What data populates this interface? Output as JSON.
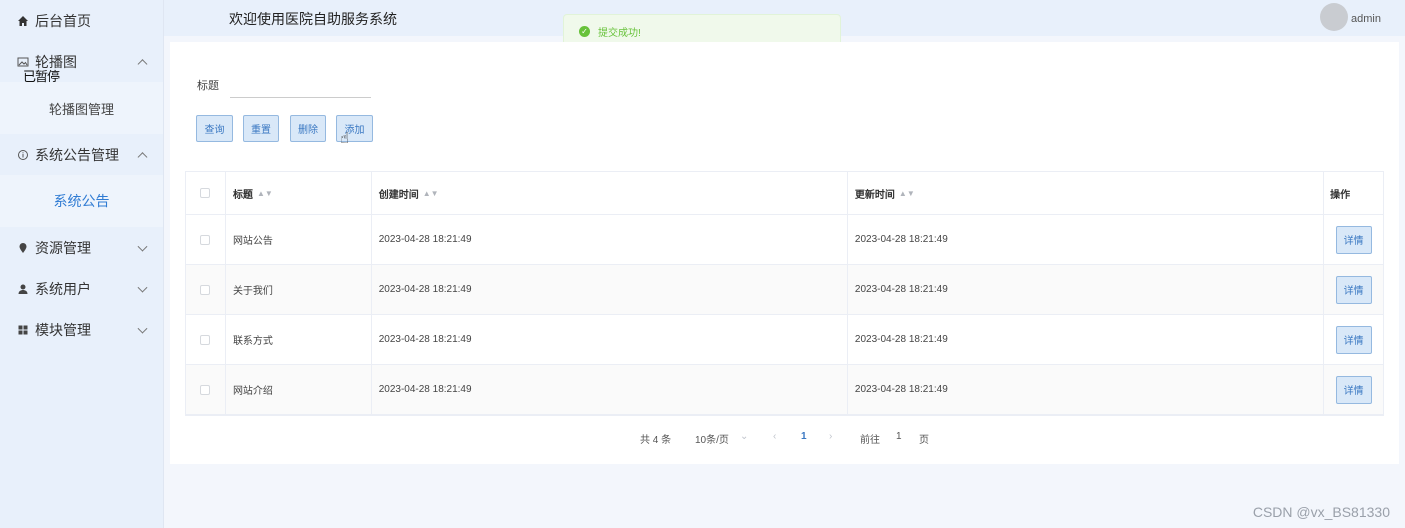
{
  "sidebar": {
    "items": [
      {
        "label": "后台首页",
        "icon": "home-icon"
      },
      {
        "label": "轮播图",
        "icon": "image-icon"
      },
      {
        "label": "轮播图管理"
      },
      {
        "label": "系统公告管理",
        "icon": "info-icon"
      },
      {
        "label": "系统公告"
      },
      {
        "label": "资源管理",
        "icon": "location-icon"
      },
      {
        "label": "系统用户",
        "icon": "user-icon"
      },
      {
        "label": "模块管理",
        "icon": "grid-icon"
      }
    ],
    "overlay_text": "已暂停"
  },
  "header": {
    "title": "欢迎使用医院自助服务系统",
    "username": "admin"
  },
  "toast": {
    "message": "提交成功!",
    "color": "#67c23a"
  },
  "search": {
    "label": "标题",
    "value": "",
    "placeholder": ""
  },
  "buttons": {
    "query": "查询",
    "reset": "重置",
    "delete": "删除",
    "add": "添加"
  },
  "table": {
    "headers": [
      "标题",
      "创建时间",
      "更新时间",
      "操作"
    ],
    "rows": [
      {
        "title": "网站公告",
        "created": "2023-04-28 18:21:49",
        "updated": "2023-04-28 18:21:49",
        "action": "详情"
      },
      {
        "title": "关于我们",
        "created": "2023-04-28 18:21:49",
        "updated": "2023-04-28 18:21:49",
        "action": "详情"
      },
      {
        "title": "联系方式",
        "created": "2023-04-28 18:21:49",
        "updated": "2023-04-28 18:21:49",
        "action": "详情"
      },
      {
        "title": "网站介绍",
        "created": "2023-04-28 18:21:49",
        "updated": "2023-04-28 18:21:49",
        "action": "详情"
      }
    ]
  },
  "pagination": {
    "total": "共 4 条",
    "page_size": "10条/页",
    "current_page": "1",
    "goto_label": "前往",
    "goto_value": "1",
    "page_suffix": "页"
  },
  "watermark": "CSDN @vx_BS81330",
  "colors": {
    "accent": "#3a78c2",
    "sidebar_bg": "#e8f0fb",
    "success": "#67c23a"
  }
}
